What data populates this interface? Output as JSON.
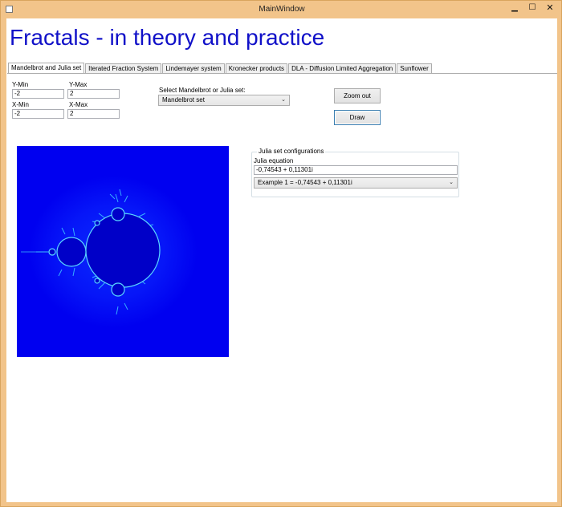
{
  "window": {
    "title": "MainWindow",
    "controls": {
      "minimize": "▁",
      "maximize": "☐",
      "close": "✕"
    }
  },
  "heading": "Fractals - in theory and practice",
  "tabs": [
    {
      "label": "Mandelbrot and Julia set",
      "active": true
    },
    {
      "label": "Iterated Fraction System",
      "active": false
    },
    {
      "label": "Lindemayer system",
      "active": false
    },
    {
      "label": "Kronecker products",
      "active": false
    },
    {
      "label": "DLA - Diffusion Limited Aggregation",
      "active": false
    },
    {
      "label": "Sunflower",
      "active": false
    }
  ],
  "ranges": {
    "y_min": {
      "label": "Y-Min",
      "value": "-2"
    },
    "y_max": {
      "label": "Y-Max",
      "value": "2"
    },
    "x_min": {
      "label": "X-Min",
      "value": "-2"
    },
    "x_max": {
      "label": "X-Max",
      "value": "2"
    }
  },
  "set_select": {
    "label": "Select Mandelbrot or Julia set:",
    "value": "Mandelbrot set"
  },
  "buttons": {
    "zoom_out": "Zoom out",
    "draw": "Draw"
  },
  "julia": {
    "group_title": "Julia set configurations",
    "equation_label": "Julia equation",
    "equation_value": "-0,74543 + 0,11301i",
    "example_value": "Example 1 = -0,74543 + 0,11301i"
  },
  "colors": {
    "heading": "#1010c8",
    "fractal_background": "#0000f0",
    "fractal_set": "#0000c8",
    "fractal_edge": "#40c8ff"
  }
}
